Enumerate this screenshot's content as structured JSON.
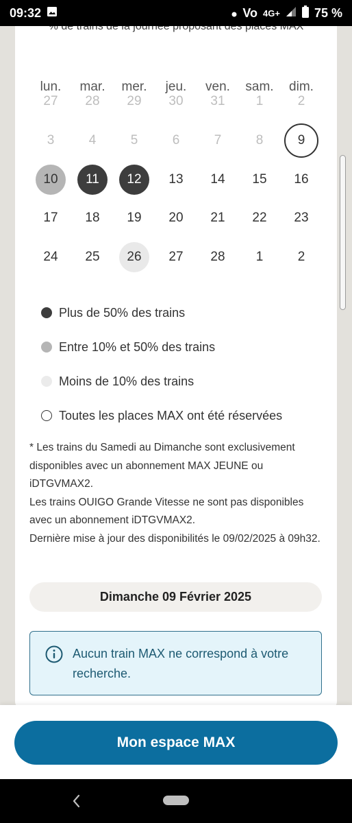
{
  "status_bar": {
    "time": "09:32",
    "network": "4G+",
    "volte": "Vo",
    "battery": "75 %",
    "icons": [
      "image-icon",
      "dot-icon",
      "volte-icon",
      "signal-icon",
      "battery-icon"
    ]
  },
  "calendar": {
    "header_note": "% de trains de la journée proposant des places MAX",
    "weekdays": [
      "lun.",
      "mar.",
      "mer.",
      "jeu.",
      "ven.",
      "sam.",
      "dim."
    ],
    "weeks": [
      [
        {
          "d": "27",
          "s": "muted"
        },
        {
          "d": "28",
          "s": "muted"
        },
        {
          "d": "29",
          "s": "muted"
        },
        {
          "d": "30",
          "s": "muted"
        },
        {
          "d": "31",
          "s": "muted"
        },
        {
          "d": "1",
          "s": "muted"
        },
        {
          "d": "2",
          "s": "muted"
        }
      ],
      [
        {
          "d": "3",
          "s": "muted"
        },
        {
          "d": "4",
          "s": "muted"
        },
        {
          "d": "5",
          "s": "muted"
        },
        {
          "d": "6",
          "s": "muted"
        },
        {
          "d": "7",
          "s": "muted"
        },
        {
          "d": "8",
          "s": "muted"
        },
        {
          "d": "9",
          "s": "full"
        }
      ],
      [
        {
          "d": "10",
          "s": "mid"
        },
        {
          "d": "11",
          "s": "high"
        },
        {
          "d": "12",
          "s": "high"
        },
        {
          "d": "13",
          "s": ""
        },
        {
          "d": "14",
          "s": ""
        },
        {
          "d": "15",
          "s": ""
        },
        {
          "d": "16",
          "s": ""
        }
      ],
      [
        {
          "d": "17",
          "s": ""
        },
        {
          "d": "18",
          "s": ""
        },
        {
          "d": "19",
          "s": ""
        },
        {
          "d": "20",
          "s": ""
        },
        {
          "d": "21",
          "s": ""
        },
        {
          "d": "22",
          "s": ""
        },
        {
          "d": "23",
          "s": ""
        }
      ],
      [
        {
          "d": "24",
          "s": ""
        },
        {
          "d": "25",
          "s": ""
        },
        {
          "d": "26",
          "s": "low"
        },
        {
          "d": "27",
          "s": ""
        },
        {
          "d": "28",
          "s": ""
        },
        {
          "d": "1",
          "s": ""
        },
        {
          "d": "2",
          "s": ""
        }
      ]
    ]
  },
  "legend": {
    "high": "Plus de 50% des trains",
    "mid": "Entre 10% et 50% des trains",
    "low": "Moins de 10% des trains",
    "full": "Toutes les places MAX ont été réservées"
  },
  "notes": {
    "line1": "* Les trains du Samedi au Dimanche sont exclusivement disponibles avec un abonnement MAX JEUNE ou iDTGVMAX2.",
    "line2": "Les trains OUIGO Grande Vitesse ne sont pas disponibles avec un abonnement iDTGVMAX2.",
    "line3": "Dernière mise à jour des disponibilités le 09/02/2025 à 09h32."
  },
  "selected_date": "Dimanche 09 Février 2025",
  "info_message": "Aucun train MAX ne correspond à votre recherche.",
  "cta_label": "Mon espace MAX",
  "colors": {
    "availability_high": "#3d3d3d",
    "availability_mid": "#b5b5b5",
    "availability_low": "#ebebeb",
    "cta": "#0c6e9f",
    "info_bg": "#e4f4fa",
    "info_text": "#1d5a72"
  }
}
